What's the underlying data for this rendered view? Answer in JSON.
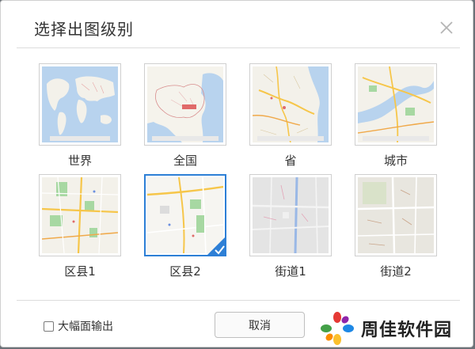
{
  "dialog": {
    "title": "选择出图级别",
    "close_icon": "close-icon"
  },
  "levels": [
    {
      "label": "世界",
      "selected": false
    },
    {
      "label": "全国",
      "selected": false
    },
    {
      "label": "省",
      "selected": false
    },
    {
      "label": "城市",
      "selected": false
    },
    {
      "label": "区县1",
      "selected": false
    },
    {
      "label": "区县2",
      "selected": true
    },
    {
      "label": "街道1",
      "selected": false
    },
    {
      "label": "街道2",
      "selected": false
    }
  ],
  "footer": {
    "large_output_label": "大幅面输出",
    "large_output_checked": false,
    "cancel_label": "取消"
  },
  "watermark": {
    "text": "周佳软件园"
  },
  "colors": {
    "accent": "#2d7fd6",
    "water": "#b8d3ee",
    "park": "#a7d8a2",
    "road_yellow": "#f6c64a"
  }
}
